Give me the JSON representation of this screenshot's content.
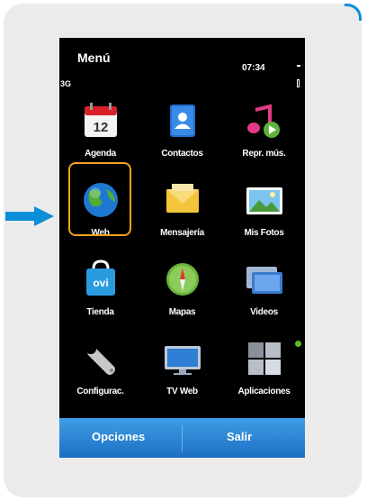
{
  "header": {
    "title": "Menú",
    "network": "3G",
    "time": "07:34"
  },
  "apps": [
    {
      "label": "Agenda",
      "icon": "calendar-icon",
      "day": "12"
    },
    {
      "label": "Contactos",
      "icon": "contacts-icon"
    },
    {
      "label": "Repr. mús.",
      "icon": "music-player-icon"
    },
    {
      "label": "Web",
      "icon": "globe-icon"
    },
    {
      "label": "Mensajería",
      "icon": "messaging-icon"
    },
    {
      "label": "Mis Fotos",
      "icon": "photos-icon"
    },
    {
      "label": "Tienda",
      "icon": "ovi-store-icon",
      "badge": "ovi"
    },
    {
      "label": "Mapas",
      "icon": "maps-icon"
    },
    {
      "label": "Videos",
      "icon": "videos-icon"
    },
    {
      "label": "Configurac.",
      "icon": "settings-wrench-icon"
    },
    {
      "label": "TV Web",
      "icon": "tv-web-icon"
    },
    {
      "label": "Aplicaciones",
      "icon": "applications-icon"
    }
  ],
  "softkeys": {
    "left": "Opciones",
    "right": "Salir"
  },
  "colors": {
    "highlight": "#f5a21b",
    "arrow": "#0a8fd8",
    "softbar": "#2b86d6"
  }
}
